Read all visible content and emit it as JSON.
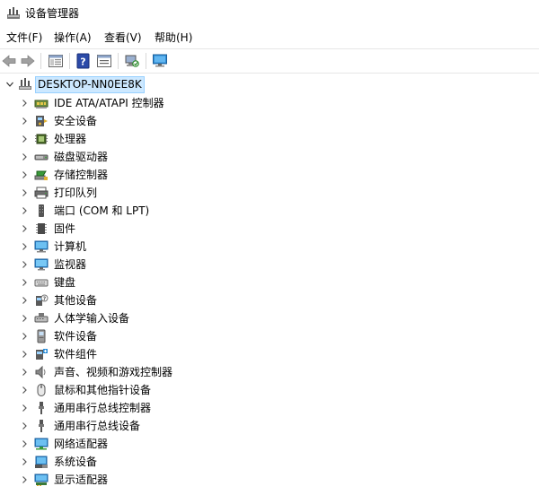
{
  "window": {
    "title": "设备管理器"
  },
  "menu": [
    {
      "label": "文件(F)"
    },
    {
      "label": "操作(A)"
    },
    {
      "label": "查看(V)"
    },
    {
      "label": "帮助(H)"
    }
  ],
  "tree": {
    "root": {
      "label": "DESKTOP-NN0EE8K"
    },
    "items": [
      {
        "label": "IDE ATA/ATAPI 控制器",
        "icon": "ide-controller-icon"
      },
      {
        "label": "安全设备",
        "icon": "security-device-icon"
      },
      {
        "label": "处理器",
        "icon": "processor-icon"
      },
      {
        "label": "磁盘驱动器",
        "icon": "disk-drive-icon"
      },
      {
        "label": "存储控制器",
        "icon": "storage-controller-icon"
      },
      {
        "label": "打印队列",
        "icon": "printer-icon"
      },
      {
        "label": "端口 (COM 和 LPT)",
        "icon": "port-icon"
      },
      {
        "label": "固件",
        "icon": "firmware-icon"
      },
      {
        "label": "计算机",
        "icon": "computer-icon"
      },
      {
        "label": "监视器",
        "icon": "monitor-icon"
      },
      {
        "label": "键盘",
        "icon": "keyboard-icon"
      },
      {
        "label": "其他设备",
        "icon": "other-device-icon"
      },
      {
        "label": "人体学输入设备",
        "icon": "hid-icon"
      },
      {
        "label": "软件设备",
        "icon": "software-device-icon"
      },
      {
        "label": "软件组件",
        "icon": "software-component-icon"
      },
      {
        "label": "声音、视频和游戏控制器",
        "icon": "speaker-icon"
      },
      {
        "label": "鼠标和其他指针设备",
        "icon": "mouse-icon"
      },
      {
        "label": "通用串行总线控制器",
        "icon": "usb-icon"
      },
      {
        "label": "通用串行总线设备",
        "icon": "usb-icon"
      },
      {
        "label": "网络适配器",
        "icon": "network-adapter-icon"
      },
      {
        "label": "系统设备",
        "icon": "system-device-icon"
      },
      {
        "label": "显示适配器",
        "icon": "display-adapter-icon"
      }
    ]
  }
}
